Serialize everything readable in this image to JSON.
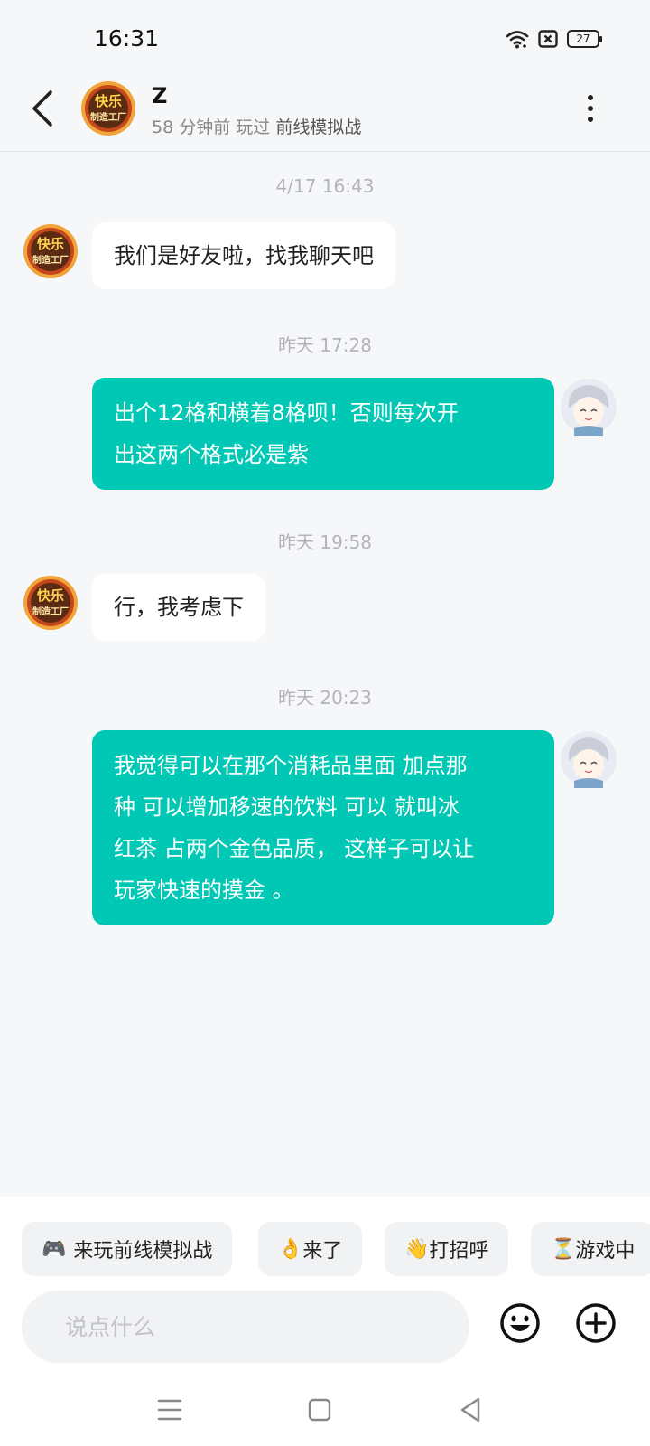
{
  "status_bar": {
    "time": "16:31",
    "battery": "27"
  },
  "header": {
    "name": "Z",
    "last_seen": "58 分钟前 玩过",
    "game": "前线模拟战",
    "avatar_text_top": "快乐",
    "avatar_text_bottom": "制造工厂"
  },
  "messages": [
    {
      "timestamp": "4/17  16:43",
      "direction": "in",
      "text": "我们是好友啦，找我聊天吧"
    },
    {
      "timestamp": "昨天  17:28",
      "direction": "out",
      "lines": [
        "出个12格和横着8格呗！否则每次开",
        "出这两个格式必是紫"
      ]
    },
    {
      "timestamp": "昨天  19:58",
      "direction": "in",
      "text": "行，我考虑下"
    },
    {
      "timestamp": "昨天  20:23",
      "direction": "out",
      "lines": [
        "我觉得可以在那个消耗品里面 加点那",
        "种 可以增加移速的饮料 可以 就叫冰",
        "红茶 占两个金色品质， 这样子可以让",
        "玩家快速的摸金 。"
      ]
    }
  ],
  "quick_replies": [
    {
      "emoji": "🎮",
      "label": "来玩前线模拟战"
    },
    {
      "emoji": "👌",
      "label": "来了"
    },
    {
      "emoji": "👋",
      "label": "打招呼"
    },
    {
      "emoji": "⏳",
      "label": "游戏中"
    }
  ],
  "input": {
    "placeholder": "说点什么"
  },
  "colors": {
    "outgoing_bubble": "#00c8b4",
    "background": "#f6f7f9"
  },
  "icons": [
    "back-icon",
    "more-icon",
    "wifi-icon",
    "sim-icon",
    "battery-icon",
    "emoji-icon",
    "plus-icon",
    "menu-icon",
    "home-icon",
    "back-nav-icon"
  ]
}
